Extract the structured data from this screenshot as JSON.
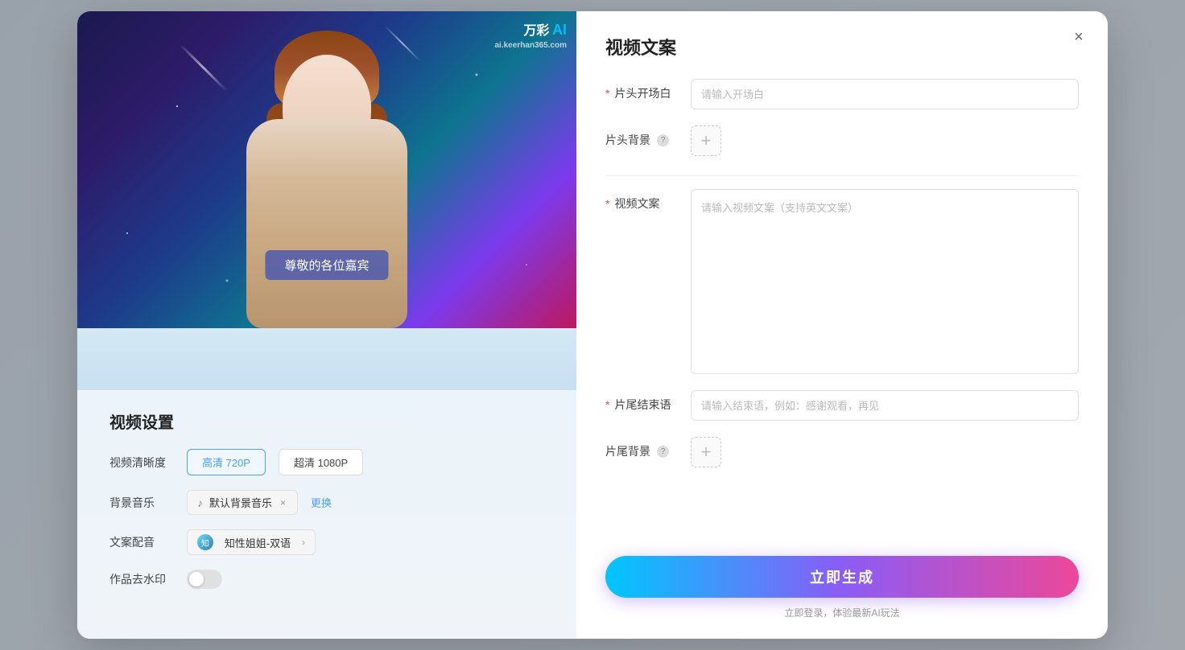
{
  "modal": {
    "close_label": "×",
    "left": {
      "watermark": {
        "cn": "万彩",
        "ai": "AI",
        "url": "ai.keerhan365.com"
      },
      "subtitle": "尊敬的各位嘉宾",
      "settings_title": "视频设置",
      "rows": [
        {
          "label": "视频清晰度",
          "type": "quality",
          "options": [
            {
              "text": "高清 720P",
              "active": true
            },
            {
              "text": "超清 1080P",
              "active": false
            }
          ]
        },
        {
          "label": "背景音乐",
          "type": "music",
          "value": "默认背景音乐",
          "change_btn": "更换"
        },
        {
          "label": "文案配音",
          "type": "voice",
          "value": "知性姐姐-双语"
        },
        {
          "label": "作品去水印",
          "type": "toggle"
        }
      ]
    },
    "right": {
      "panel_title": "视频文案",
      "form": {
        "opening_label": "片头开场白",
        "opening_required": true,
        "opening_placeholder": "请输入开场白",
        "header_bg_label": "片头背景",
        "header_bg_help": true,
        "video_copy_label": "视频文案",
        "video_copy_required": true,
        "video_copy_placeholder": "请输入视频文案（支持英文文案）",
        "ending_label": "片尾结束语",
        "ending_required": true,
        "ending_placeholder": "请输入结束语，例如：感谢观看，再见",
        "footer_bg_label": "片尾背景",
        "footer_bg_help": true
      },
      "generate_btn": "立即生成",
      "login_hint": "立即登录，体验最新AI玩法"
    }
  }
}
